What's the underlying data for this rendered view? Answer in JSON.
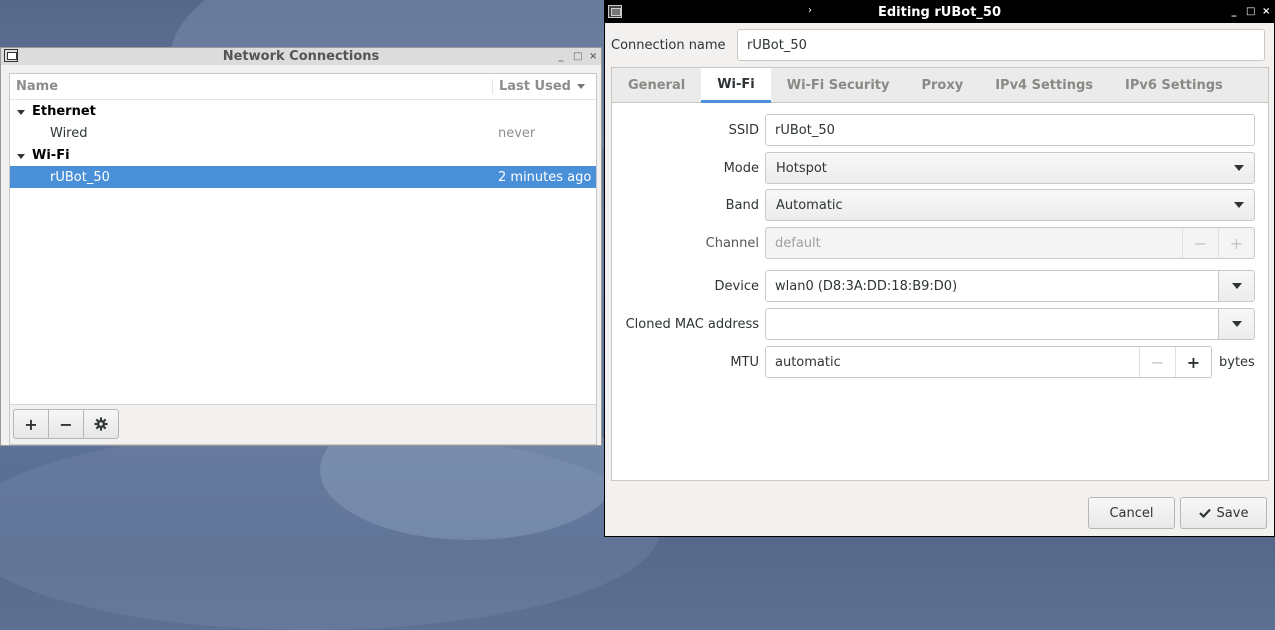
{
  "network_connections": {
    "title": "Network Connections",
    "columns": {
      "name": "Name",
      "last_used": "Last Used"
    },
    "groups": [
      {
        "label": "Ethernet",
        "items": [
          {
            "name": "Wired",
            "last_used": "never"
          }
        ]
      },
      {
        "label": "Wi-Fi",
        "items": [
          {
            "name": "rUBot_50",
            "last_used": "2 minutes ago",
            "selected": true
          }
        ]
      }
    ],
    "toolbar": {
      "add": "+",
      "remove": "−",
      "settings_icon": "gear-icon"
    }
  },
  "editor": {
    "title": "Editing rUBot_50",
    "title_mark": "›",
    "connection_name_label": "Connection name",
    "connection_name_value": "rUBot_50",
    "tabs": [
      "General",
      "Wi-Fi",
      "Wi-Fi Security",
      "Proxy",
      "IPv4 Settings",
      "IPv6 Settings"
    ],
    "active_tab": "Wi-Fi",
    "fields": {
      "ssid_label": "SSID",
      "ssid_value": "rUBot_50",
      "mode_label": "Mode",
      "mode_value": "Hotspot",
      "band_label": "Band",
      "band_value": "Automatic",
      "channel_label": "Channel",
      "channel_placeholder": "default",
      "device_label": "Device",
      "device_value": "wlan0 (D8:3A:DD:18:B9:D0)",
      "cloned_mac_label": "Cloned MAC address",
      "cloned_mac_value": "",
      "mtu_label": "MTU",
      "mtu_value": "automatic",
      "mtu_unit": "bytes",
      "minus": "−",
      "plus": "+"
    },
    "buttons": {
      "cancel": "Cancel",
      "save": "Save"
    }
  },
  "window_controls": {
    "minimize": "_",
    "maximize": "□",
    "close": "×"
  }
}
